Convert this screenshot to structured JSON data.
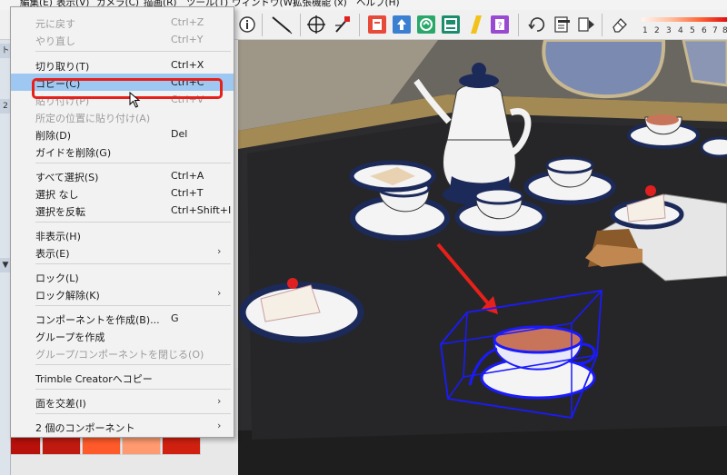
{
  "menubar": {
    "items": [
      "編集(E)",
      "表示(V)",
      "カメラ(C)",
      "描画(R)",
      "ツール(T)",
      "ウィンドウ(W)",
      "拡張機能 (x)",
      "ヘルプ(H)"
    ]
  },
  "toolbar": {
    "icons": [
      "info-icon",
      "pen-tool-icon",
      "section-plane-icon",
      "section-tool-icon",
      "export-red-icon",
      "upload-blue-icon",
      "warehouse-green-icon",
      "layout-green-icon",
      "yellow-stripe-icon",
      "purple-extension-icon",
      "rotate-icon",
      "pages-icon",
      "forward-icon",
      "eraser-icon"
    ],
    "scale_labels": [
      "1",
      "2",
      "3",
      "4",
      "5",
      "6",
      "7",
      "8"
    ]
  },
  "side_tabs": [
    "ト",
    "2",
    "▼"
  ],
  "context_menu": {
    "items": [
      {
        "label": "元に戻す",
        "shortcut": "Ctrl+Z",
        "disabled": true
      },
      {
        "label": "やり直し",
        "shortcut": "Ctrl+Y",
        "disabled": true
      },
      {
        "label": "切り取り(T)",
        "shortcut": "Ctrl+X",
        "disabled": false
      },
      {
        "label": "コピー(C)",
        "shortcut": "Ctrl+C",
        "disabled": false,
        "highlighted": true
      },
      {
        "label": "貼り付け(P)",
        "shortcut": "Ctrl+V",
        "disabled": true
      },
      {
        "label": "所定の位置に貼り付け(A)",
        "shortcut": "",
        "disabled": true
      },
      {
        "label": "削除(D)",
        "shortcut": "Del",
        "disabled": false
      },
      {
        "label": "ガイドを削除(G)",
        "shortcut": "",
        "disabled": false
      },
      {
        "label": "すべて選択(S)",
        "shortcut": "Ctrl+A",
        "disabled": false
      },
      {
        "label": "選択 なし",
        "shortcut": "Ctrl+T",
        "disabled": false
      },
      {
        "label": "選択を反転",
        "shortcut": "Ctrl+Shift+I",
        "disabled": false
      },
      {
        "label": "非表示(H)",
        "shortcut": "",
        "disabled": false
      },
      {
        "label": "表示(E)",
        "shortcut": "",
        "disabled": false,
        "submenu": true
      },
      {
        "label": "ロック(L)",
        "shortcut": "",
        "disabled": false
      },
      {
        "label": "ロック解除(K)",
        "shortcut": "",
        "disabled": false,
        "submenu": true
      },
      {
        "label": "コンポーネントを作成(B)...",
        "shortcut": "G",
        "disabled": false
      },
      {
        "label": "グループを作成",
        "shortcut": "",
        "disabled": false
      },
      {
        "label": "グループ/コンポーネントを閉じる(O)",
        "shortcut": "",
        "disabled": true
      },
      {
        "label": "Trimble Creatorへコピー",
        "shortcut": "",
        "disabled": false
      },
      {
        "label": "面を交差(I)",
        "shortcut": "",
        "disabled": false,
        "submenu": true
      },
      {
        "label": "2 個のコンポーネント",
        "shortcut": "",
        "disabled": false,
        "submenu": true
      }
    ],
    "submenu_glyph": "›"
  },
  "palette": {
    "colors": [
      "#f7d7d2",
      "#f3c4bc",
      "#ee9a8e",
      "#e6342a",
      "#f2f2f2",
      "#c8281e",
      "#c92a20",
      "#ffd0c0",
      "#ff9270",
      "#a40c0c",
      "#b01414",
      "#e02418",
      "#ff8a60",
      "#ffa27e",
      "#cc1c10",
      "#b8100a",
      "#c01a10",
      "#ff5a2a",
      "#ff9a70",
      "#d02010"
    ]
  },
  "colors": {
    "highlight": "#9ec8f2",
    "callout": "#e8201a",
    "selection": "#1a1aff"
  }
}
